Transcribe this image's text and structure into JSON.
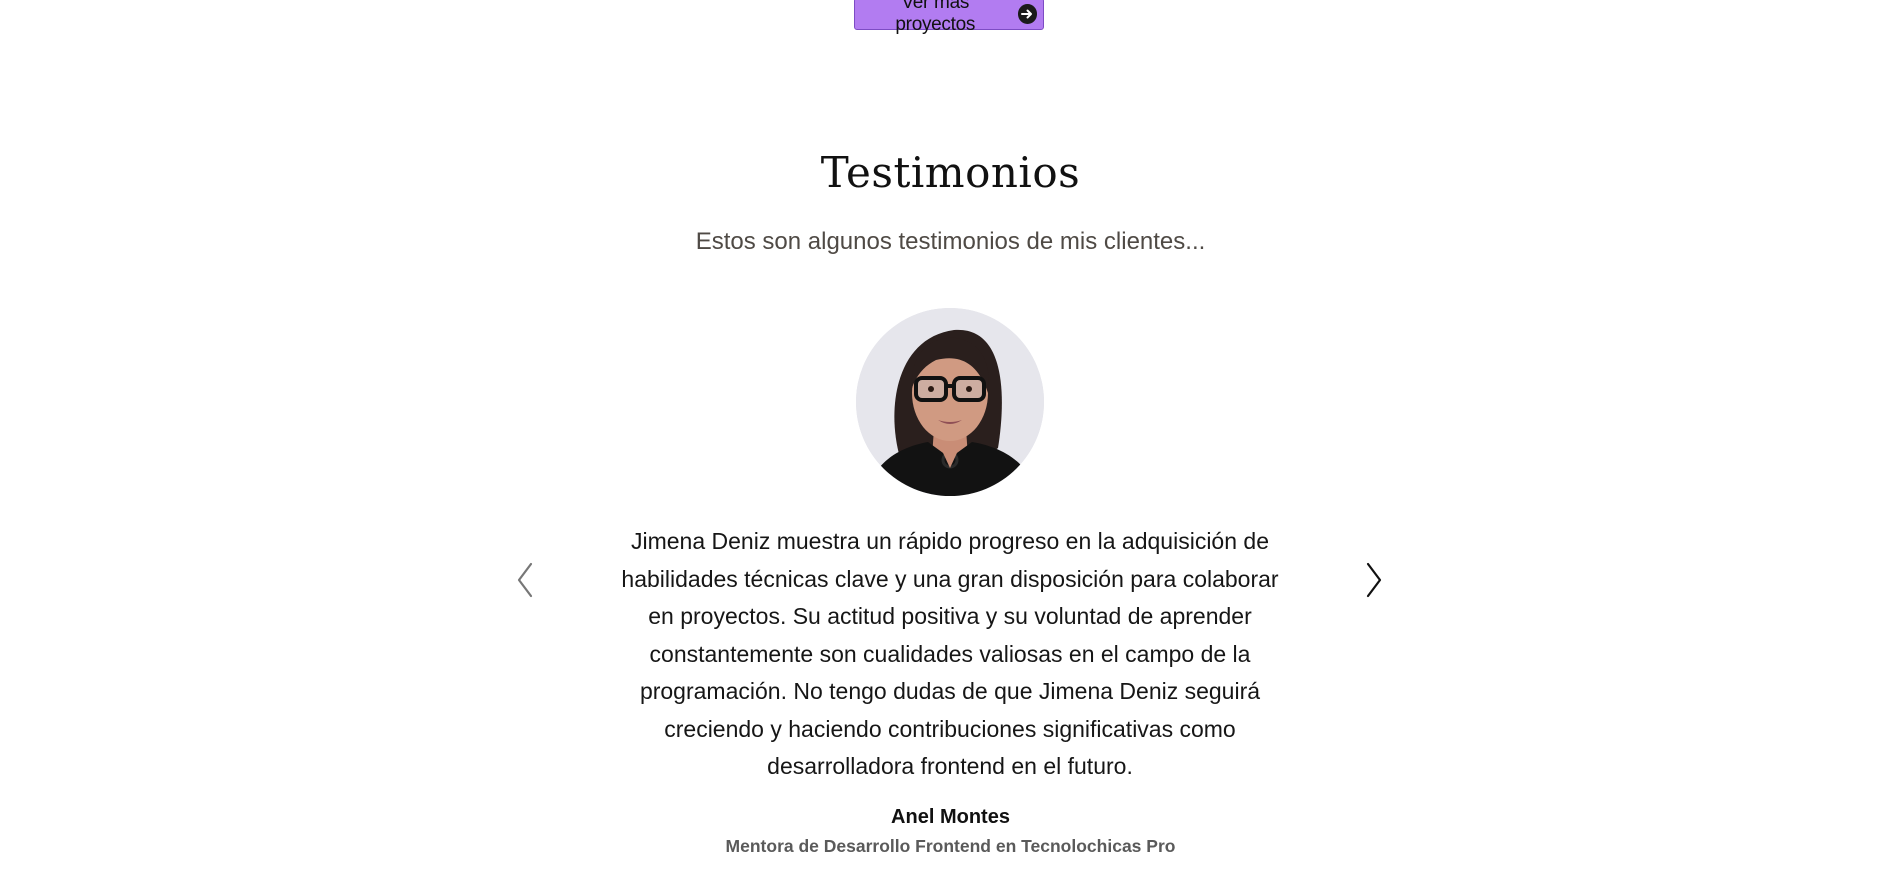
{
  "projects": {
    "more_button_label": "Ver más proyectos",
    "more_button_icon": "arrow-right-circle-icon",
    "accent_color": "#b27cf1"
  },
  "testimonials": {
    "title": "Testimonios",
    "subtitle": "Estos son algunos testimonios de mis clientes...",
    "current": {
      "avatar_alt": "Foto de Jimena Deniz",
      "quote": "Jimena Deniz muestra un rápido progreso en la adquisición de habilidades técnicas clave y una gran disposición para colaborar en proyectos. Su actitud positiva y su voluntad de aprender constantemente son cualidades valiosas en el campo de la programación. No tengo dudas de que Jimena Deniz seguirá creciendo y haciendo contribuciones significativas como desarrolladora frontend en el futuro.",
      "author": "Anel Montes",
      "role": "Mentora de Desarrollo Frontend en Tecnolochicas Pro"
    },
    "prev_icon": "chevron-left-icon",
    "next_icon": "chevron-right-icon"
  }
}
